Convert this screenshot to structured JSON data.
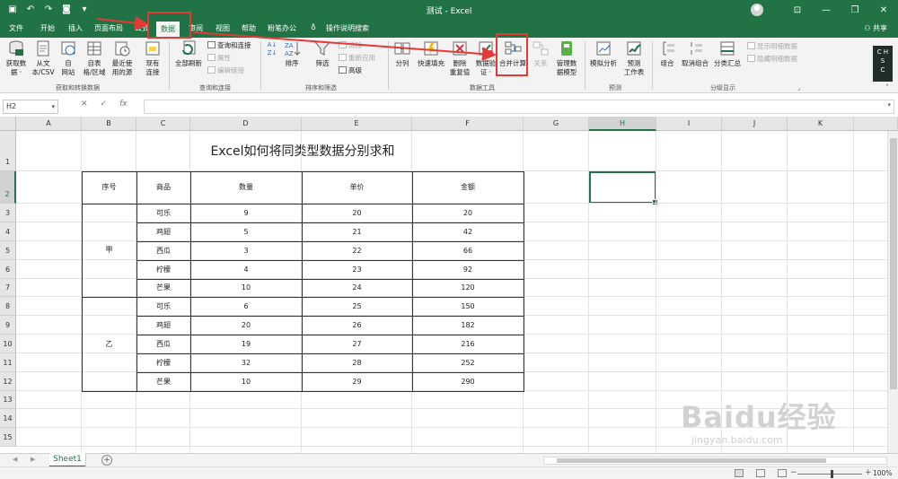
{
  "window": {
    "title": "测试 - Excel",
    "share_label": "共享"
  },
  "quick_access": [
    "save-icon",
    "undo-icon",
    "redo-icon",
    "camera-icon",
    "customize-icon"
  ],
  "tabs": [
    {
      "label": "文件"
    },
    {
      "label": "开始"
    },
    {
      "label": "插入"
    },
    {
      "label": "页面布局"
    },
    {
      "label": "公式"
    },
    {
      "label": "数据",
      "active": true
    },
    {
      "label": "审阅"
    },
    {
      "label": "视图"
    },
    {
      "label": "帮助"
    },
    {
      "label": "粉笔办公"
    },
    {
      "label": "操作说明搜索"
    }
  ],
  "ribbon": {
    "groups": [
      {
        "label": "获取和转换数据",
        "buttons": [
          {
            "label": "获取数\n据 ·",
            "icon": "database-icon"
          },
          {
            "label": "从文\n本/CSV",
            "icon": "text-file-icon"
          },
          {
            "label": "自\n网站",
            "icon": "web-icon"
          },
          {
            "label": "自表\n格/区域",
            "icon": "table-range-icon"
          },
          {
            "label": "最近使\n用的源",
            "icon": "recent-source-icon"
          },
          {
            "label": "现有\n连接",
            "icon": "existing-connection-icon"
          }
        ]
      },
      {
        "label": "查询和连接",
        "buttons": [
          {
            "label": "全部刷新",
            "icon": "refresh-icon"
          }
        ],
        "small": [
          {
            "label": "查询和连接",
            "disabled": false
          },
          {
            "label": "属性",
            "disabled": true
          },
          {
            "label": "编辑链接",
            "disabled": true
          }
        ]
      },
      {
        "label": "排序和筛选",
        "buttons": [
          {
            "label": "排序",
            "icon": "sort-icon"
          },
          {
            "label": "筛选",
            "icon": "filter-icon"
          }
        ],
        "small": [
          {
            "label": "清除",
            "disabled": true
          },
          {
            "label": "重新应用",
            "disabled": true
          },
          {
            "label": "高级",
            "disabled": false
          }
        ]
      },
      {
        "label": "数据工具",
        "buttons": [
          {
            "label": "分列",
            "icon": "split-column-icon"
          },
          {
            "label": "快速填充",
            "icon": "flash-fill-icon"
          },
          {
            "label": "删除\n重复值",
            "icon": "remove-duplicates-icon"
          },
          {
            "label": "数据验\n证 ·",
            "icon": "data-validation-icon"
          },
          {
            "label": "合并计算",
            "icon": "consolidate-icon"
          },
          {
            "label": "关系",
            "icon": "relationships-icon",
            "disabled": true
          },
          {
            "label": "管理数\n据模型",
            "icon": "data-model-icon"
          }
        ]
      },
      {
        "label": "预测",
        "buttons": [
          {
            "label": "模拟分析",
            "icon": "what-if-icon"
          },
          {
            "label": "预测\n工作表",
            "icon": "forecast-icon"
          }
        ]
      },
      {
        "label": "分级显示",
        "buttons": [
          {
            "label": "组合",
            "icon": "group-icon"
          },
          {
            "label": "取消组合",
            "icon": "ungroup-icon"
          },
          {
            "label": "分类汇总",
            "icon": "subtotal-icon"
          }
        ],
        "small": [
          {
            "label": "显示明细数据",
            "disabled": true
          },
          {
            "label": "隐藏明细数据",
            "disabled": true
          }
        ]
      }
    ]
  },
  "ime": {
    "lines": [
      "C H",
      "S",
      "C"
    ]
  },
  "formula_bar": {
    "name_box": "H2",
    "fx": "fx",
    "value": ""
  },
  "columns": [
    {
      "label": "A"
    },
    {
      "label": "B"
    },
    {
      "label": "C"
    },
    {
      "label": "D"
    },
    {
      "label": "E"
    },
    {
      "label": "F"
    },
    {
      "label": "G"
    },
    {
      "label": "H",
      "selected": true
    },
    {
      "label": "I"
    },
    {
      "label": "J"
    },
    {
      "label": "K"
    },
    {
      "label": ""
    }
  ],
  "rows": [
    "1",
    "2",
    "3",
    "4",
    "5",
    "6",
    "7",
    "8",
    "9",
    "10",
    "11",
    "12",
    "13",
    "14",
    "15"
  ],
  "sheet": {
    "title": "Excel如何将同类型数据分别求和",
    "headers": [
      "序号",
      "商品",
      "数量",
      "单价",
      "金额"
    ],
    "groups": [
      "甲",
      "乙"
    ],
    "data": [
      [
        "可乐",
        "9",
        "20",
        "20"
      ],
      [
        "鸡翅",
        "5",
        "21",
        "42"
      ],
      [
        "西瓜",
        "3",
        "22",
        "66"
      ],
      [
        "柠檬",
        "4",
        "23",
        "92"
      ],
      [
        "芒果",
        "10",
        "24",
        "120"
      ],
      [
        "可乐",
        "6",
        "25",
        "150"
      ],
      [
        "鸡翅",
        "20",
        "26",
        "182"
      ],
      [
        "西瓜",
        "19",
        "27",
        "216"
      ],
      [
        "柠檬",
        "32",
        "28",
        "252"
      ],
      [
        "芒果",
        "10",
        "29",
        "290"
      ]
    ]
  },
  "sheet_tabs": [
    {
      "label": "Sheet1",
      "active": true
    }
  ],
  "status": {
    "zoom": "100%"
  },
  "watermark": {
    "brand": "Baidu经验",
    "url": "jingyan.baidu.com"
  },
  "colors": {
    "accent": "#217346",
    "annotation": "#e53935"
  }
}
